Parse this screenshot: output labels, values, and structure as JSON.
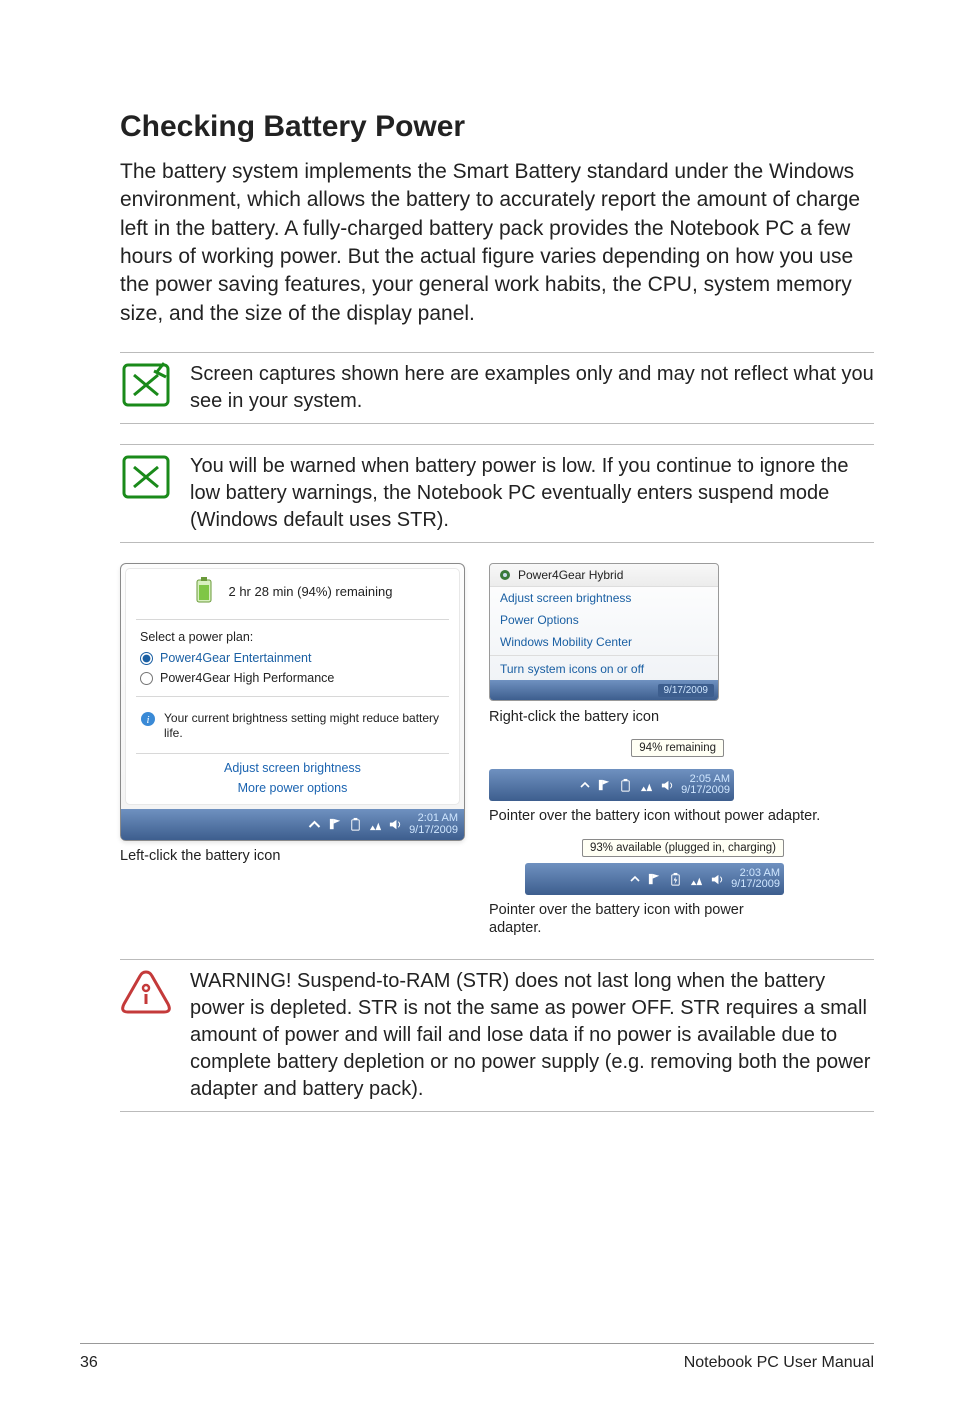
{
  "heading": "Checking Battery Power",
  "intro": "The battery system implements the Smart Battery standard under the Windows environment, which allows the battery to accurately report the amount of charge left in the battery. A fully-charged battery pack provides the Notebook PC a few hours of working power. But the actual figure varies depending on how you use the power saving features, your general work habits, the CPU, system memory size, and the size of the display panel.",
  "note1": "Screen captures shown here are examples only and may not reflect what you see in your system.",
  "note2": "You will be warned when battery power is low. If you continue to ignore the low battery warnings, the Notebook PC eventually enters suspend mode (Windows default uses STR).",
  "warning": "WARNING!  Suspend-to-RAM (STR) does not last long when the battery power is depleted. STR is not the same as power OFF. STR requires a small amount of power and will fail and lose data if no power is available due to complete battery depletion or no power supply (e.g. removing both the power adapter and battery pack).",
  "footer": {
    "page": "36",
    "book": "Notebook PC User Manual"
  },
  "flyout": {
    "remaining": "2 hr 28 min (94%) remaining",
    "plan_title": "Select a power plan:",
    "plans": [
      "Power4Gear Entertainment",
      "Power4Gear High Performance"
    ],
    "info": "Your current brightness setting might reduce battery life.",
    "links": [
      "Adjust screen brightness",
      "More power options"
    ],
    "clock": {
      "time": "2:01 AM",
      "date": "9/17/2009"
    }
  },
  "caption_left": "Left-click the battery icon",
  "p4g": {
    "title": "Power4Gear Hybrid",
    "items": [
      "Adjust screen brightness",
      "Power Options",
      "Windows Mobility Center"
    ],
    "foot": "Turn system icons on or off",
    "frag_date": "9/17/2009"
  },
  "right_label": "Right-click the battery icon",
  "hover1": {
    "tip": "94% remaining",
    "clock": {
      "time": "2:05 AM",
      "date": "9/17/2009"
    }
  },
  "caption_hover1": "Pointer over the battery icon without power adapter.",
  "hover2": {
    "tip": "93% available (plugged in, charging)",
    "clock": {
      "time": "2:03 AM",
      "date": "9/17/2009"
    }
  },
  "caption_hover2": "Pointer over the battery icon with power adapter."
}
